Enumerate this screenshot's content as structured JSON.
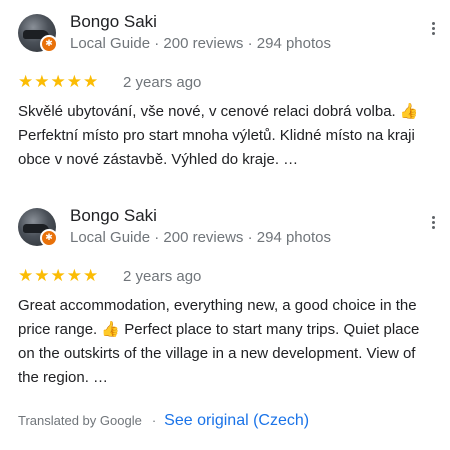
{
  "reviews": [
    {
      "name": "Bongo Saki",
      "meta": "Local Guide · 200 reviews · 294 photos",
      "stars": "★★★★★",
      "rating": 5,
      "date": "2 years ago",
      "text": "Skvělé ubytování, vše nové, v cenové relaci dobrá volba. 👍 Perfektní místo pro start mnoha výletů. Klidné místo na kraji obce v nové zástavbě. Výhled do kraje. …"
    },
    {
      "name": "Bongo Saki",
      "meta": "Local Guide · 200 reviews · 294 photos",
      "stars": "★★★★★",
      "rating": 5,
      "date": "2 years ago",
      "text": "Great accommodation, everything new, a good choice in the price range. 👍 Perfect place to start many trips. Quiet place on the outskirts of the village in a new development. View of the region. …"
    }
  ],
  "footer": {
    "translated_by": "Translated by Google",
    "separator": "·",
    "see_original": "See original (Czech)"
  },
  "colors": {
    "star": "#fbbc04",
    "link": "#1a73e8",
    "badge": "#e8710a",
    "muted": "#70757a"
  },
  "icons": {
    "more": "more-vert-icon",
    "badge": "local-guide-badge-icon"
  }
}
